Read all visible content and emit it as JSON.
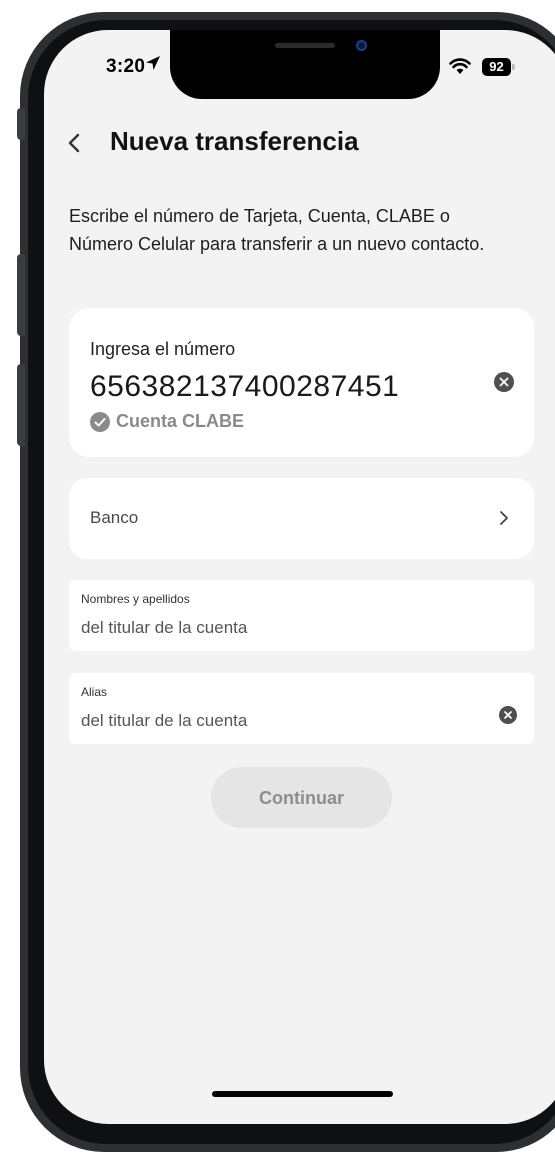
{
  "status_bar": {
    "time": "3:20",
    "battery": "92"
  },
  "header": {
    "title": "Nueva transferencia"
  },
  "description": "Escribe el número de Tarjeta, Cuenta, CLABE o Número Celular para transferir a un nuevo contacto.",
  "number_field": {
    "label": "Ingresa el número",
    "value": "656382137400287451",
    "detected_type": "Cuenta CLABE"
  },
  "bank_field": {
    "label": "Banco"
  },
  "name_field": {
    "label": "Nombres y apellidos",
    "placeholder": "del titular de la cuenta"
  },
  "alias_field": {
    "label": "Alias",
    "placeholder": "del titular de la cuenta"
  },
  "continue_button": {
    "label": "Continuar"
  },
  "colors": {
    "background": "#f3f3f3",
    "card": "#ffffff",
    "button_disabled": "#e5e5e5",
    "button_text_disabled": "#8d8d8d"
  },
  "icons": [
    "location-arrow-icon",
    "signal-icon",
    "wifi-icon",
    "battery-icon",
    "back-chevron-icon",
    "clear-icon",
    "check-circle-icon",
    "chevron-right-icon"
  ]
}
